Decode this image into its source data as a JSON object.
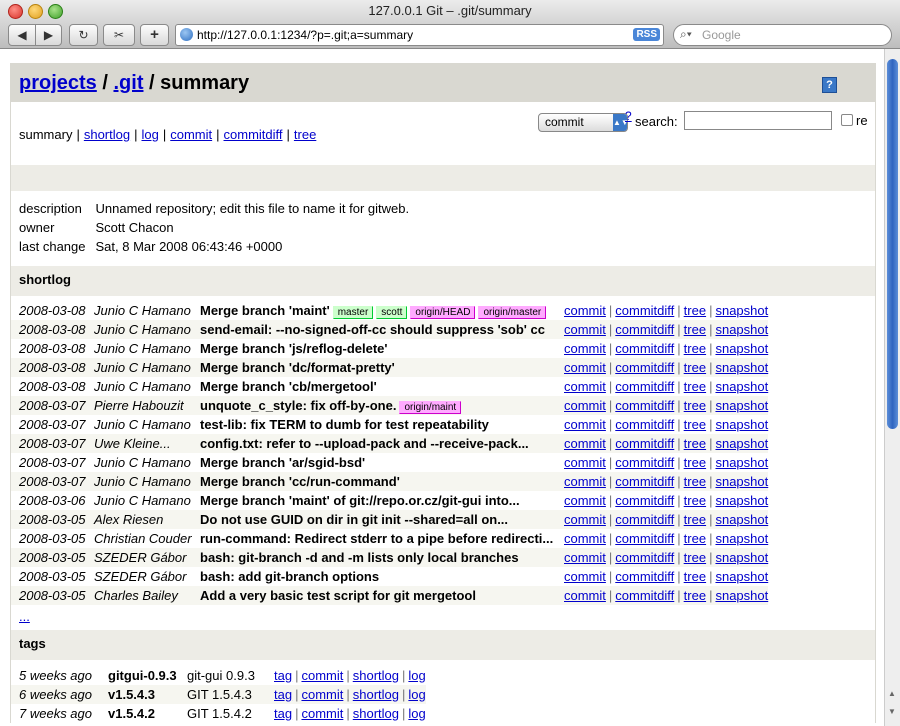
{
  "window": {
    "title": "127.0.0.1 Git – .git/summary"
  },
  "toolbar": {
    "back_icon": "◀",
    "forward_icon": "▶",
    "reload_icon": "↻",
    "capture_icon": "✂",
    "add_icon": "+",
    "url": "http://127.0.0.1:1234/?p=.git;a=summary",
    "rss_label": "RSS",
    "search_placeholder": "Google"
  },
  "header": {
    "projects_link": "projects",
    "sep1": " / ",
    "git_link": ".git",
    "sep2": " / ",
    "page": "summary",
    "help_icon": "?"
  },
  "nav": {
    "current": "summary",
    "links": [
      "shortlog",
      "log",
      "commit",
      "commitdiff",
      "tree"
    ],
    "search_type": "commit",
    "help_q": "?",
    "search_label": "search:",
    "search_value": "",
    "re_label": "re"
  },
  "project": {
    "rows": [
      {
        "label": "description",
        "value": "Unnamed repository; edit this file to name it for gitweb."
      },
      {
        "label": "owner",
        "value": "Scott Chacon"
      },
      {
        "label": "last change",
        "value": "Sat, 8 Mar 2008 06:43:46 +0000"
      }
    ]
  },
  "shortlog": {
    "title": "shortlog",
    "link_labels": {
      "commit": "commit",
      "commitdiff": "commitdiff",
      "tree": "tree",
      "snapshot": "snapshot",
      "sep": "|"
    },
    "rows": [
      {
        "date": "2008-03-08",
        "author": "Junio C Hamano",
        "subject": "Merge branch 'maint'",
        "refs": [
          {
            "name": "master",
            "type": "head"
          },
          {
            "name": "scott",
            "type": "head"
          },
          {
            "name": "origin/HEAD",
            "type": "remote"
          },
          {
            "name": "origin/master",
            "type": "remote"
          }
        ]
      },
      {
        "date": "2008-03-08",
        "author": "Junio C Hamano",
        "subject": "send-email: --no-signed-off-cc should suppress 'sob' cc",
        "refs": []
      },
      {
        "date": "2008-03-08",
        "author": "Junio C Hamano",
        "subject": "Merge branch 'js/reflog-delete'",
        "refs": []
      },
      {
        "date": "2008-03-08",
        "author": "Junio C Hamano",
        "subject": "Merge branch 'dc/format-pretty'",
        "refs": []
      },
      {
        "date": "2008-03-08",
        "author": "Junio C Hamano",
        "subject": "Merge branch 'cb/mergetool'",
        "refs": []
      },
      {
        "date": "2008-03-07",
        "author": "Pierre Habouzit",
        "subject": "unquote_c_style: fix off-by-one.",
        "refs": [
          {
            "name": "origin/maint",
            "type": "remote"
          }
        ]
      },
      {
        "date": "2008-03-07",
        "author": "Junio C Hamano",
        "subject": "test-lib: fix TERM to dumb for test repeatability",
        "refs": []
      },
      {
        "date": "2008-03-07",
        "author": "Uwe Kleine...",
        "subject": "config.txt: refer to --upload-pack and --receive-pack...",
        "refs": []
      },
      {
        "date": "2008-03-07",
        "author": "Junio C Hamano",
        "subject": "Merge branch 'ar/sgid-bsd'",
        "refs": []
      },
      {
        "date": "2008-03-07",
        "author": "Junio C Hamano",
        "subject": "Merge branch 'cc/run-command'",
        "refs": []
      },
      {
        "date": "2008-03-06",
        "author": "Junio C Hamano",
        "subject": "Merge branch 'maint' of git://repo.or.cz/git-gui into...",
        "refs": []
      },
      {
        "date": "2008-03-05",
        "author": "Alex Riesen",
        "subject": "Do not use GUID on dir in git init --shared=all on...",
        "refs": []
      },
      {
        "date": "2008-03-05",
        "author": "Christian Couder",
        "subject": "run-command: Redirect stderr to a pipe before redirecti...",
        "refs": []
      },
      {
        "date": "2008-03-05",
        "author": "SZEDER Gábor",
        "subject": "bash: git-branch -d and -m lists only local branches",
        "refs": []
      },
      {
        "date": "2008-03-05",
        "author": "SZEDER Gábor",
        "subject": "bash: add git-branch options",
        "refs": []
      },
      {
        "date": "2008-03-05",
        "author": "Charles Bailey",
        "subject": "Add a very basic test script for git mergetool",
        "refs": []
      }
    ],
    "more": "..."
  },
  "tags": {
    "title": "tags",
    "link_labels": {
      "tag": "tag",
      "commit": "commit",
      "shortlog": "shortlog",
      "log": "log",
      "sep": "|"
    },
    "rows": [
      {
        "age": "5 weeks ago",
        "name": "gitgui-0.9.3",
        "comment": "git-gui 0.9.3"
      },
      {
        "age": "6 weeks ago",
        "name": "v1.5.4.3",
        "comment": "GIT 1.5.4.3"
      },
      {
        "age": "7 weeks ago",
        "name": "v1.5.4.2",
        "comment": "GIT 1.5.4.2"
      }
    ]
  }
}
